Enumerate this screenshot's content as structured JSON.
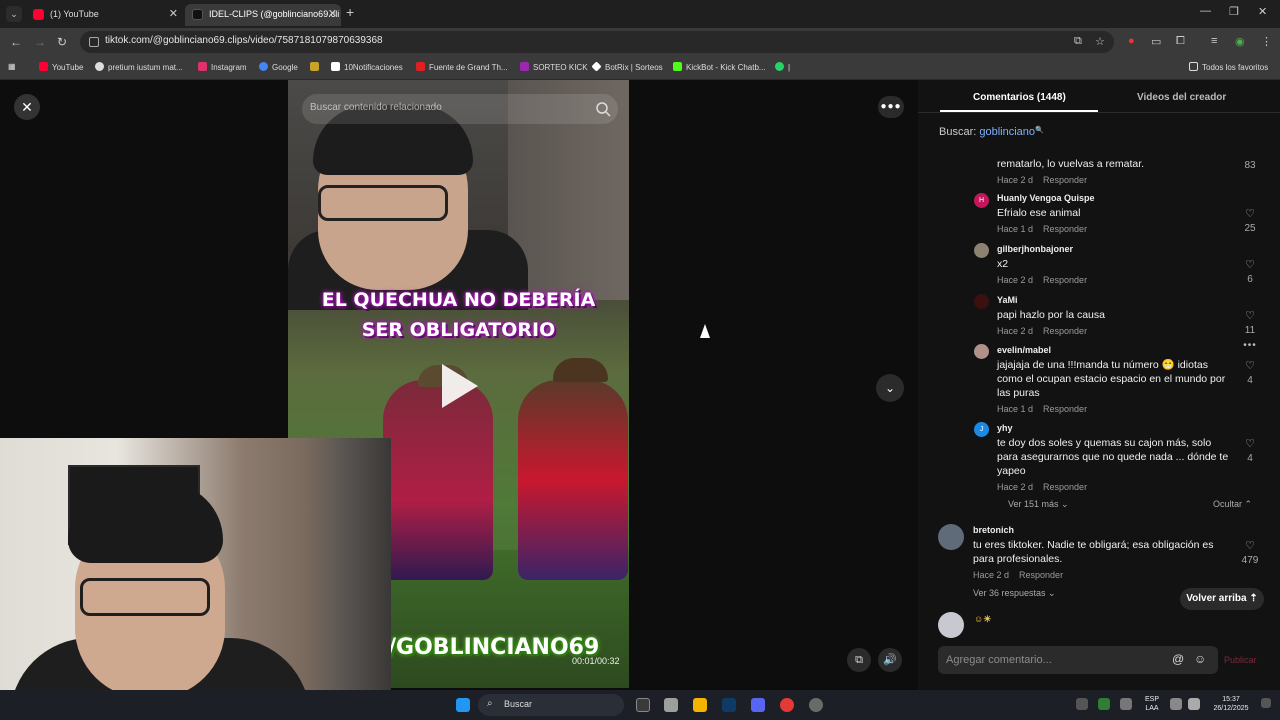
{
  "browser": {
    "tabs": [
      {
        "title": "(1) YouTube",
        "favicon_color": "#ff0033"
      },
      {
        "title": "IDEL-CLIPS (@goblinciano69.cli",
        "favicon_color": "#111111"
      }
    ],
    "url": "tiktok.com/@goblinciano69.clips/video/7587181079870639368",
    "bookmarks": [
      {
        "label": "YouTube",
        "color": "#ff0033"
      },
      {
        "label": "pretium iustum mat...",
        "color": "#dddddd"
      },
      {
        "label": "Instagram",
        "color": "#e1306c"
      },
      {
        "label": "Google",
        "color": "#4285f4"
      },
      {
        "label": "",
        "color": "#c9a227"
      },
      {
        "label": "10Notificaciones",
        "color": "#ffffff"
      },
      {
        "label": "Fuente de Grand Th...",
        "color": "#e02020"
      },
      {
        "label": "SORTEO KICK",
        "color": "#9c27b0"
      },
      {
        "label": "BotRix | Sorteos",
        "color": "#ffffff"
      },
      {
        "label": "KickBot - Kick Chatb...",
        "color": "#53fc18"
      },
      {
        "label": "|",
        "color": "#25d366"
      }
    ],
    "bookmarks_all": "Todos los favoritos"
  },
  "video": {
    "search_placeholder": "Buscar contenido relacionado",
    "title_line1": "EL QUECHUA NO DEBERÍA",
    "title_line2": "SER OBLIGATORIO",
    "handle": "/GOBLINCIANO69",
    "time": "00:01/00:32"
  },
  "panel": {
    "tab_comments": "Comentarios (1448)",
    "tab_videos": "Videos del creador",
    "search_label": "Buscar:",
    "search_term": "goblinciano",
    "comments": [
      {
        "user": "",
        "text": "rematarlo, lo vuelvas a rematar.",
        "time": "Hace 2 d",
        "reply": "Responder",
        "likes": "83",
        "avatar": "",
        "avatar_color": "#121212"
      },
      {
        "user": "Huanly Vengoa Quispe",
        "text": "Efrialo ese animal",
        "time": "Hace 1 d",
        "reply": "Responder",
        "likes": "25",
        "avatar": "H",
        "avatar_color": "#c2185b"
      },
      {
        "user": "gilberjhonbajoner",
        "text": "x2",
        "time": "Hace 2 d",
        "reply": "Responder",
        "likes": "6",
        "avatar": "",
        "avatar_color": "#8d8270"
      },
      {
        "user": "YaMi",
        "text": "papi hazlo por la causa",
        "time": "Hace 2 d",
        "reply": "Responder",
        "likes": "11",
        "avatar": "",
        "avatar_color": "#3a1010"
      },
      {
        "user": "evelin/mabel",
        "text": "jajajaja de una !!!manda tu número 😁 idiotas como el ocupan estacio espacio en el mundo por las puras",
        "time": "Hace 1 d",
        "reply": "Responder",
        "likes": "4",
        "avatar": "",
        "avatar_color": "#b0908a"
      },
      {
        "user": "yhy",
        "text": "te doy dos soles y quemas su cajon más, solo para asegurarnos que no quede nada ... dónde te yapeo",
        "time": "Hace 2 d",
        "reply": "Responder",
        "likes": "4",
        "avatar": "J",
        "avatar_color": "#1e88e5"
      }
    ],
    "ver_mas": "Ver 151 más",
    "ocultar": "Ocultar",
    "top_comment": {
      "user": "bretonich",
      "text": "tu eres tiktoker. Nadie te obligará; esa obligación es para profesionales.",
      "time": "Hace 2 d",
      "reply": "Responder",
      "likes": "479"
    },
    "ver_respuestas": "Ver 36 respuestas",
    "volver_arriba": "Volver arriba",
    "add_comment_placeholder": "Agregar comentario...",
    "publicar": "Publicar"
  },
  "taskbar": {
    "search": "Buscar",
    "lang1": "ESP",
    "lang2": "LAA",
    "time": "15:37",
    "date": "26/12/2025"
  }
}
